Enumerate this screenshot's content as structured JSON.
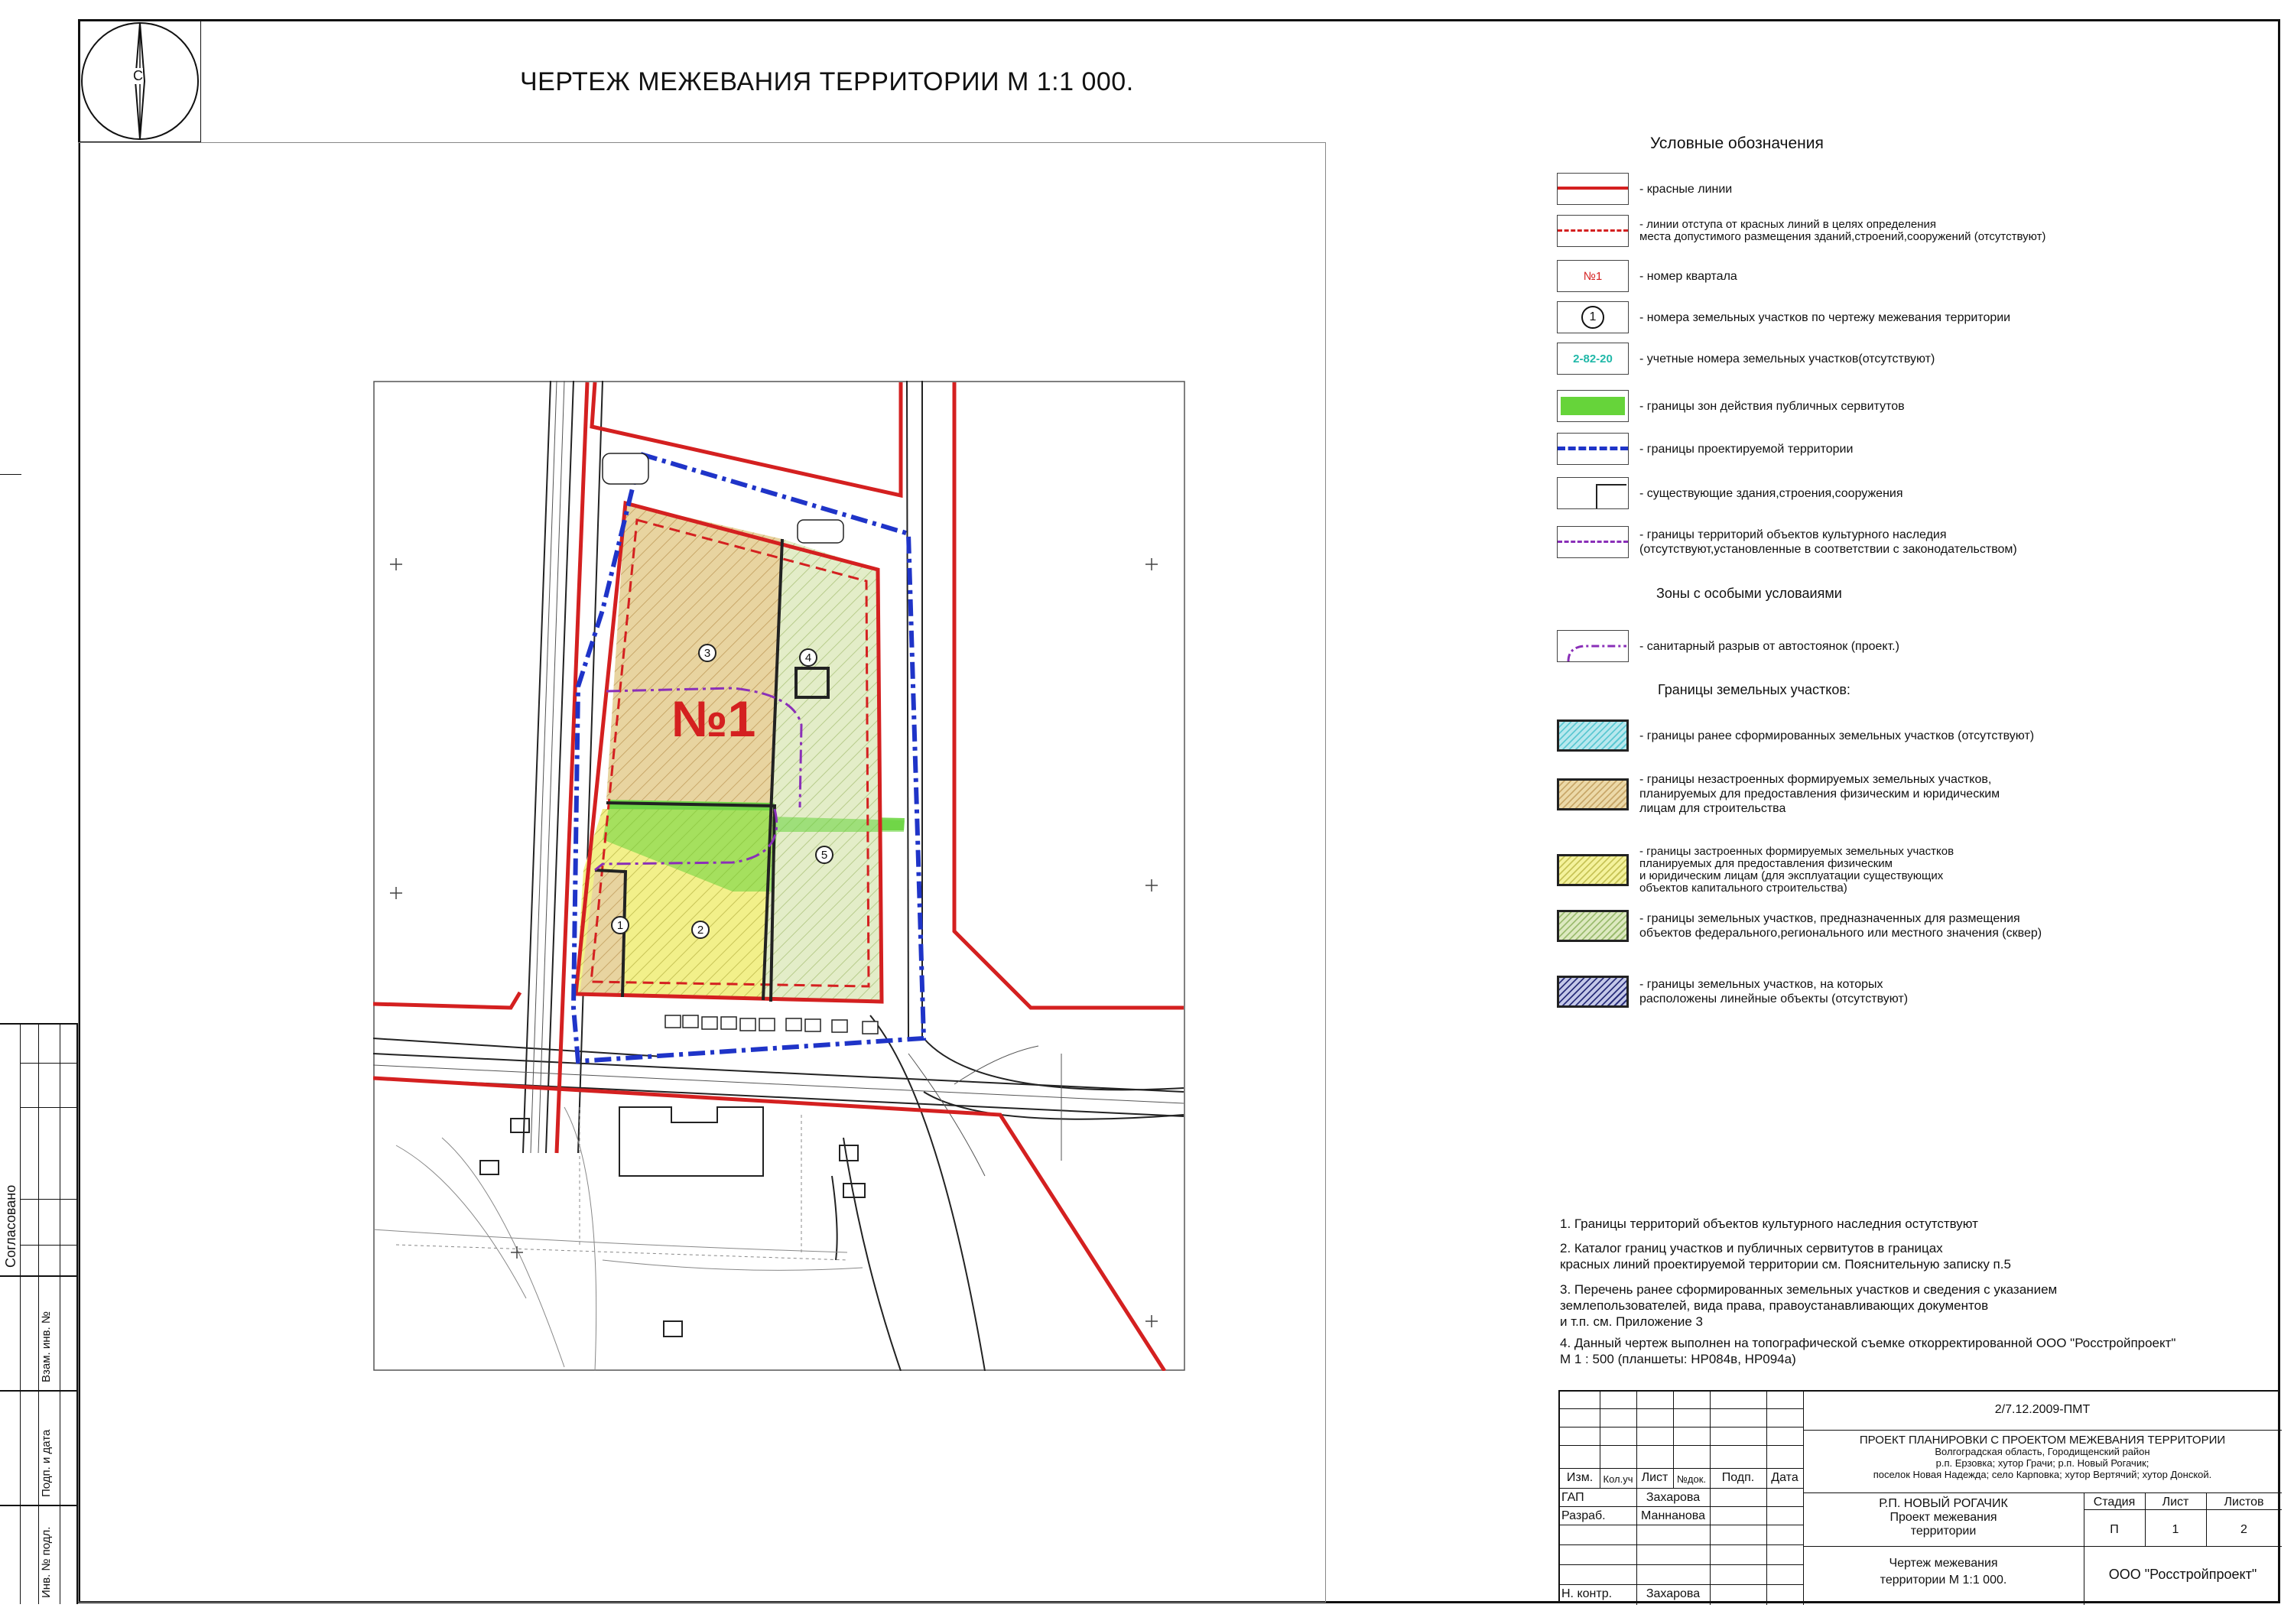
{
  "title": "ЧЕРТЕЖ МЕЖЕВАНИЯ ТЕРРИТОРИИ  М 1:1 000.",
  "north_letter": "С",
  "map": {
    "quarter_label": "№1",
    "parcels": [
      "1",
      "2",
      "3",
      "4",
      "5"
    ]
  },
  "colors": {
    "red_line": "#d42020",
    "blue_boundary": "#1f34c8",
    "servitude_green": "#66d43a",
    "purple": "#8a2fb8",
    "parcel_orange": "#e8d4a0",
    "parcel_yellow": "#f2f08a",
    "parcel_green": "#dde9c0",
    "cadastral_teal": "#20b8a8"
  },
  "legend": {
    "heading": "Условные обозначения",
    "items": [
      {
        "icon": "red-solid-line",
        "text": "- красные линии"
      },
      {
        "icon": "red-dashed-line",
        "text": "- линии отступа от красных линий в целях определения\n  места допустимого размещения зданий,строений,сооружений (отсутствуют)"
      },
      {
        "icon": "quarter-number",
        "sample": "№1",
        "text": "- номер квартала"
      },
      {
        "icon": "circle-number",
        "sample": "1",
        "text": "- номера земельных участков по чертежу межевания территории"
      },
      {
        "icon": "cadastral-number",
        "sample": "2-82-20",
        "text": "- учетные номера земельных участков(отсутствуют)"
      },
      {
        "icon": "green-servitude",
        "text": "- границы зон действия публичных сервитутов"
      },
      {
        "icon": "blue-dashdot-line",
        "text": "- границы проектируемой территории"
      },
      {
        "icon": "building-outline",
        "text": "- существующие здания,строения,сооружения"
      },
      {
        "icon": "purple-dashdot-line",
        "text": "- границы территорий объектов культурного наследия\n  (отсутствуют,установленные в соответствии с законодательством)"
      }
    ],
    "special_heading": "Зоны с особыми условаиями",
    "special_items": [
      {
        "icon": "purple-sanitary-line",
        "text": "- санитарный разрыв от автостоянок (проект.)"
      }
    ],
    "parcels_heading": "Границы земельных участков:",
    "parcel_items": [
      {
        "icon": "teal-hatch",
        "text": "- границы ранее сформированных  земельных участков (отсутствуют)"
      },
      {
        "icon": "orange-hatch",
        "text": "- границы незастроенных формируемых  земельных участков,\n  планируемых для  предоставления физическим и юридическим\n  лицам для строительства"
      },
      {
        "icon": "yellow-hatch",
        "text": "- границы застроенных формируемых земельных участков\n  планируемых для предоставления физическим\n  и юридическим лицам (для эксплуатации существующих\n  объектов капитального строительства)"
      },
      {
        "icon": "green-hatch",
        "text": "- границы земельных участков, предназначенных для размещения\n  объектов  федерального,регионального или местного значения  (сквер)"
      },
      {
        "icon": "navy-hatch",
        "text": "- границы земельных участков, на которых\n  расположены линейные объекты (отсутствуют)"
      }
    ]
  },
  "notes": [
    "1. Границы территорий объектов культурного наследния остутствуют",
    "2. Каталог границ участков и публичных сервитутов в границах\nкрасных линий проектируемой территории см. Пояснительную записку п.5",
    "3. Перечень ранее сформированных земельных участков и сведения с указанием\nземлепользователей, вида права, правоустанавливающих документов\nи т.п. см.  Приложение 3",
    "4. Данный чертеж выполнен на топографической съемке откорректированной ООО \"Росстройпроект\"\n М 1 : 500 (планшеты: НР084в, НР094а)"
  ],
  "title_block": {
    "code": "2/7.12.2009-ПМТ",
    "project": "ПРОЕКТ ПЛАНИРОВКИ С ПРОЕКТОМ МЕЖЕВАНИЯ ТЕРРИТОРИИ",
    "region": "Волгоградская область, Городищенский район",
    "localities_1": "р.п. Ерзовка; хутор Грачи; р.п. Новый Рогачик;",
    "localities_2": "поселок Новая Надежда; село Карповка; хутор Вертячий; хутор Донской.",
    "col_headers": [
      "Изм.",
      "Кол.уч",
      "Лист",
      "№док.",
      "Подп.",
      "Дата"
    ],
    "roles": [
      {
        "role": "ГАП",
        "name": "Захарова"
      },
      {
        "role": "Разраб.",
        "name": "Маннанова"
      },
      {
        "role": "Н. контр.",
        "name": "Захарова"
      }
    ],
    "object_1": "Р.П. НОВЫЙ РОГАЧИК",
    "object_2": "Проект межевания",
    "object_3": "территории",
    "drawing_1": "Чертеж межевания",
    "drawing_2": "территории М 1:1 000.",
    "stage_label": "Стадия",
    "sheet_label": "Лист",
    "sheets_label": "Листов",
    "stage": "П",
    "sheet": "1",
    "sheets": "2",
    "company": "ООО \"Росстройпроект\""
  },
  "side_stamp": {
    "agreed": "Согласовано",
    "vzam": "Взам. инв. №",
    "podp": "Подп. и дата",
    "inv": "Инв. № подл."
  }
}
